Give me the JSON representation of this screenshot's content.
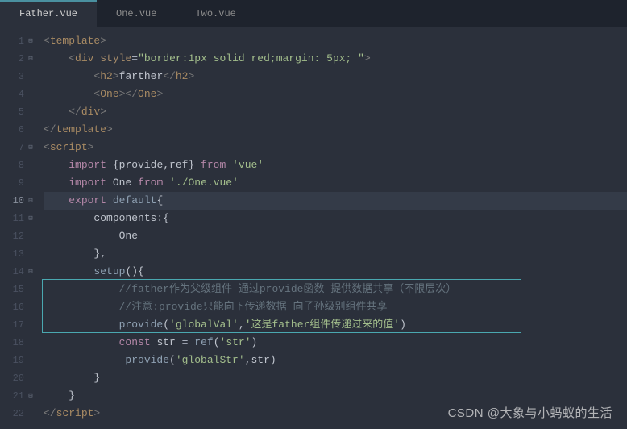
{
  "tabs": [
    {
      "label": "Father.vue",
      "active": true
    },
    {
      "label": "One.vue",
      "active": false
    },
    {
      "label": "Two.vue",
      "active": false
    }
  ],
  "gutter": {
    "lines": [
      "1",
      "2",
      "3",
      "4",
      "5",
      "6",
      "7",
      "8",
      "9",
      "10",
      "11",
      "12",
      "13",
      "14",
      "15",
      "16",
      "17",
      "18",
      "19",
      "20",
      "21",
      "22"
    ],
    "fold_at": [
      1,
      2,
      7,
      10,
      11,
      14,
      21
    ],
    "highlighted": 10
  },
  "code": {
    "l1_tag": "template",
    "l2_tag": "div",
    "l2_attr": "style",
    "l2_val": "\"border:1px solid red;margin: 5px; \"",
    "l3_tag": "h2",
    "l3_text": "farther",
    "l4_tag": "One",
    "l7_tag": "script",
    "l8_import": "import",
    "l8_braces": "{provide,ref}",
    "l8_from": "from",
    "l8_mod": "'vue'",
    "l9_import": "import",
    "l9_name": "One",
    "l9_from": "from",
    "l9_path": "'./One.vue'",
    "l10_export": "export",
    "l10_default": "default",
    "l11_components": "components:",
    "l12_one": "One",
    "l14_setup": "setup",
    "l15_comment": "//father作为父级组件 通过provide函数 提供数据共享（不限层次）",
    "l16_comment": "//注意:provide只能向下传递数据 向子孙级别组件共享",
    "l17_provide": "provide",
    "l17_arg1": "'globalVal'",
    "l17_arg2": "'这是father组件传递过来的值'",
    "l18_const": "const",
    "l18_var": "str",
    "l18_ref": "ref",
    "l18_arg": "'str'",
    "l19_provide": "provide",
    "l19_arg1": "'globalStr'",
    "l19_arg2": "str"
  },
  "watermark": "CSDN @大象与小蚂蚁的生活"
}
